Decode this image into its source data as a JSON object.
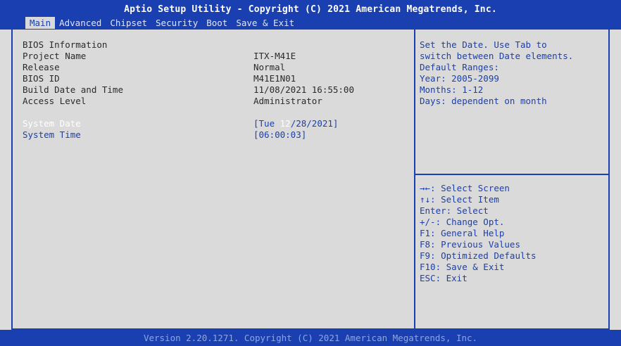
{
  "header": {
    "title": "Aptio Setup Utility - Copyright (C) 2021 American Megatrends, Inc.",
    "tabs": [
      "Main",
      "Advanced",
      "Chipset",
      "Security",
      "Boot",
      "Save & Exit"
    ],
    "active_tab": "Main"
  },
  "main": {
    "section_title": "BIOS Information",
    "info_rows": [
      {
        "label": "Project Name",
        "value": "ITX-M41E"
      },
      {
        "label": "Release",
        "value": "Normal"
      },
      {
        "label": "BIOS ID",
        "value": "M41E1N01"
      },
      {
        "label": "Build Date and Time",
        "value": "11/08/2021 16:55:00"
      },
      {
        "label": "Access Level",
        "value": "Administrator"
      }
    ],
    "system_date": {
      "label": "System Date",
      "prefix": "[Tue ",
      "highlighted": "12",
      "suffix": "/28/2021]"
    },
    "system_time": {
      "label": "System Time",
      "value": "[06:00:03]"
    }
  },
  "help": {
    "description": [
      "Set the Date. Use Tab to",
      "switch between Date elements.",
      "Default Ranges:",
      "Year: 2005-2099",
      "Months: 1-12",
      "Days: dependent on month"
    ],
    "keys": [
      "→←: Select Screen",
      "↑↓: Select Item",
      "Enter: Select",
      "+/-: Change Opt.",
      "F1: General Help",
      "F8: Previous Values",
      "F9: Optimized Defaults",
      "F10: Save & Exit",
      "ESC: Exit"
    ]
  },
  "footer": {
    "text": "Version 2.20.1271. Copyright (C) 2021 American Megatrends, Inc."
  },
  "colors": {
    "primary": "#1a3fb0",
    "background": "#dadada",
    "text": "#2a2a2a",
    "highlight": "#ffffff"
  }
}
